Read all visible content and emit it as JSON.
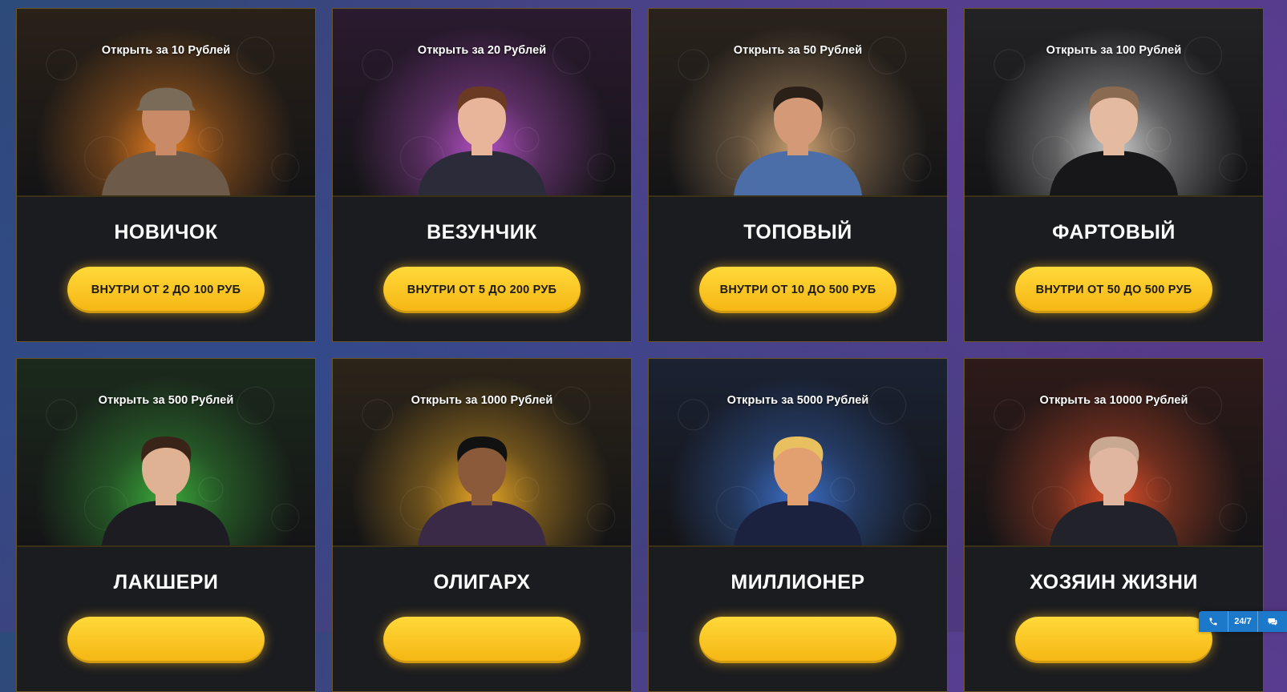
{
  "cards": [
    {
      "price_label": "Открыть за 10 Рублей",
      "title": "НОВИЧОК",
      "button_label": "ВНУТРИ ОТ 2 ДО 100 РУБ",
      "glow": "#e07a1f",
      "bg": "#2a2118",
      "skin": "#c98a68",
      "outfit": "#6d5a48",
      "hat": "#7a6a58"
    },
    {
      "price_label": "Открыть за 20 Рублей",
      "title": "ВЕЗУНЧИК",
      "button_label": "ВНУТРИ ОТ 5 ДО 200 РУБ",
      "glow": "#b04fc0",
      "bg": "#2b1a30",
      "skin": "#e8b49a",
      "outfit": "#2b2b3a",
      "hair": "#6a3a22"
    },
    {
      "price_label": "Открыть за 50 Рублей",
      "title": "ТОПОВЫЙ",
      "button_label": "ВНУТРИ ОТ 10 ДО 500 РУБ",
      "glow": "#c9a070",
      "bg": "#2a231c",
      "skin": "#d49a78",
      "outfit": "#4b6ea8",
      "hair": "#2a2018"
    },
    {
      "price_label": "Открыть за 100 Рублей",
      "title": "ФАРТОВЫЙ",
      "button_label": "ВНУТРИ ОТ 50 ДО 500 РУБ",
      "glow": "#c8c8c8",
      "bg": "#232326",
      "skin": "#e4bba0",
      "outfit": "#17171a",
      "hair": "#8a6a50"
    },
    {
      "price_label": "Открыть за 500 Рублей",
      "title": "ЛАКШЕРИ",
      "button_label": "",
      "glow": "#3aa83a",
      "bg": "#1b2a1c",
      "skin": "#e0b294",
      "outfit": "#1c1c22",
      "hair": "#3a2418"
    },
    {
      "price_label": "Открыть за 1000 Рублей",
      "title": "ОЛИГАРХ",
      "button_label": "",
      "glow": "#e7a524",
      "bg": "#2b2418",
      "skin": "#8a5a3a",
      "outfit": "#3a2a48",
      "hair": "#111111"
    },
    {
      "price_label": "Открыть за 5000 Рублей",
      "title": "МИЛЛИОНЕР",
      "button_label": "",
      "glow": "#3b6ec8",
      "bg": "#1a2233",
      "skin": "#e2a070",
      "outfit": "#1b2240",
      "hair": "#e8c060"
    },
    {
      "price_label": "Открыть за 10000 Рублей",
      "title": "ХОЗЯИН ЖИЗНИ",
      "button_label": "",
      "glow": "#e0502a",
      "bg": "#2e1a18",
      "skin": "#e0b6a0",
      "outfit": "#22222a",
      "hair": "#c8a890"
    }
  ],
  "support": {
    "phone_icon": "phone-icon",
    "hours_label": "24/7",
    "chat_icon": "chat-icon",
    "color": "#1c78c9"
  }
}
